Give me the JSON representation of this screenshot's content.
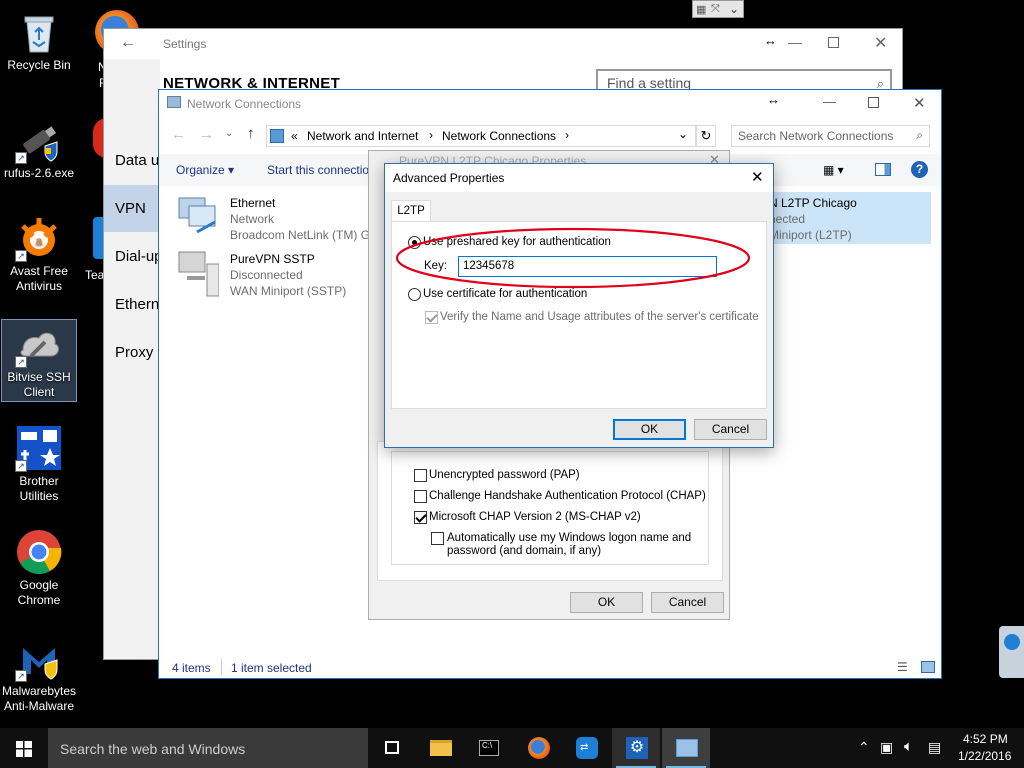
{
  "desktop": {
    "icons": [
      {
        "label": "Recycle Bin"
      },
      {
        "label": "rufus-2.6.exe"
      },
      {
        "label": "Avast Free Antivirus"
      },
      {
        "label": "Bitvise SSH Client"
      },
      {
        "label": "Brother Utilities"
      },
      {
        "label": "Google Chrome"
      },
      {
        "label": "Malwarebytes Anti-Malware"
      }
    ],
    "partial_labels": [
      "N",
      "F",
      "Tea"
    ]
  },
  "settings": {
    "title": "Settings",
    "heading": "NETWORK & INTERNET",
    "search_placeholder": "Find a setting",
    "nav": [
      {
        "label": "Data u"
      },
      {
        "label": "VPN"
      },
      {
        "label": "Dial-up"
      },
      {
        "label": "Etherne"
      },
      {
        "label": "Proxy"
      }
    ]
  },
  "netconn": {
    "title": "Network Connections",
    "breadcrumb": {
      "prefix": "«",
      "items": [
        "Network and Internet",
        "Network Connections"
      ]
    },
    "search_placeholder": "Search Network Connections",
    "toolbar": {
      "organize": "Organize",
      "start": "Start this connectio"
    },
    "connections": [
      {
        "name": "Ethernet",
        "status": "Network",
        "device": "Broadcom NetLink (TM) G"
      },
      {
        "name": "PureVPN SSTP",
        "status": "Disconnected",
        "device": "WAN Miniport (SSTP)"
      },
      {
        "name": "N L2TP Chicago",
        "status": "nected",
        "device": "Miniport (L2TP)"
      }
    ],
    "status_bar": {
      "items": "4 items",
      "selected": "1 item selected"
    }
  },
  "props": {
    "title": "PureVPN L2TP Chicago Properties",
    "options": [
      {
        "label": "Unencrypted password (PAP)",
        "checked": false
      },
      {
        "label": "Challenge Handshake Authentication Protocol (CHAP)",
        "checked": false
      },
      {
        "label": "Microsoft CHAP Version 2 (MS-CHAP v2)",
        "checked": true
      }
    ],
    "auto_logon": {
      "line1": "Automatically use my Windows logon name and",
      "line2": "password (and domain, if any)",
      "checked": false
    },
    "ok": "OK",
    "cancel": "Cancel"
  },
  "advanced": {
    "title": "Advanced Properties",
    "tab": "L2TP",
    "preshared_label": "Use preshared key for authentication",
    "key_label": "Key:",
    "key_value": "12345678",
    "certificate_label": "Use certificate for authentication",
    "verify_label": "Verify the Name and Usage attributes of the server's certificate",
    "ok": "OK",
    "cancel": "Cancel",
    "highlight_color": "#e0001b"
  },
  "taskbar": {
    "search_placeholder": "Search the web and Windows",
    "time": "4:52 PM",
    "date": "1/22/2016"
  }
}
